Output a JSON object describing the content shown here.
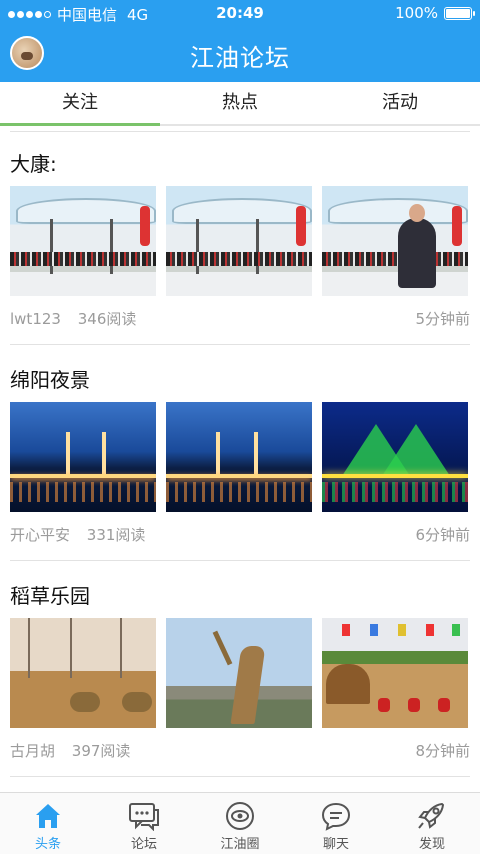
{
  "status_bar": {
    "carrier": "中国电信",
    "network": "4G",
    "time": "20:49",
    "battery_percent": "100%"
  },
  "header": {
    "title": "江油论坛",
    "avatar_icon": "user-avatar"
  },
  "tabs": [
    {
      "label": "关注",
      "active": true
    },
    {
      "label": "热点",
      "active": false
    },
    {
      "label": "活动",
      "active": false
    }
  ],
  "posts": [
    {
      "title": "大康:",
      "author": "lwt123",
      "reads": "346阅读",
      "time": "5分钟前"
    },
    {
      "title": "绵阳夜景",
      "author": "开心平安",
      "reads": "331阅读",
      "time": "6分钟前"
    },
    {
      "title": "稻草乐园",
      "author": "古月胡",
      "reads": "397阅读",
      "time": "8分钟前"
    }
  ],
  "bottom_nav": [
    {
      "label": "头条",
      "icon": "home-icon",
      "active": true
    },
    {
      "label": "论坛",
      "icon": "chat-bubble-icon",
      "active": false
    },
    {
      "label": "江油圈",
      "icon": "eye-circle-icon",
      "active": false
    },
    {
      "label": "聊天",
      "icon": "speech-icon",
      "active": false
    },
    {
      "label": "发现",
      "icon": "rocket-icon",
      "active": false
    }
  ],
  "colors": {
    "header_bg": "#2a9ff0",
    "tab_underline": "#7ac36a",
    "nav_active": "#2a9ff0"
  }
}
